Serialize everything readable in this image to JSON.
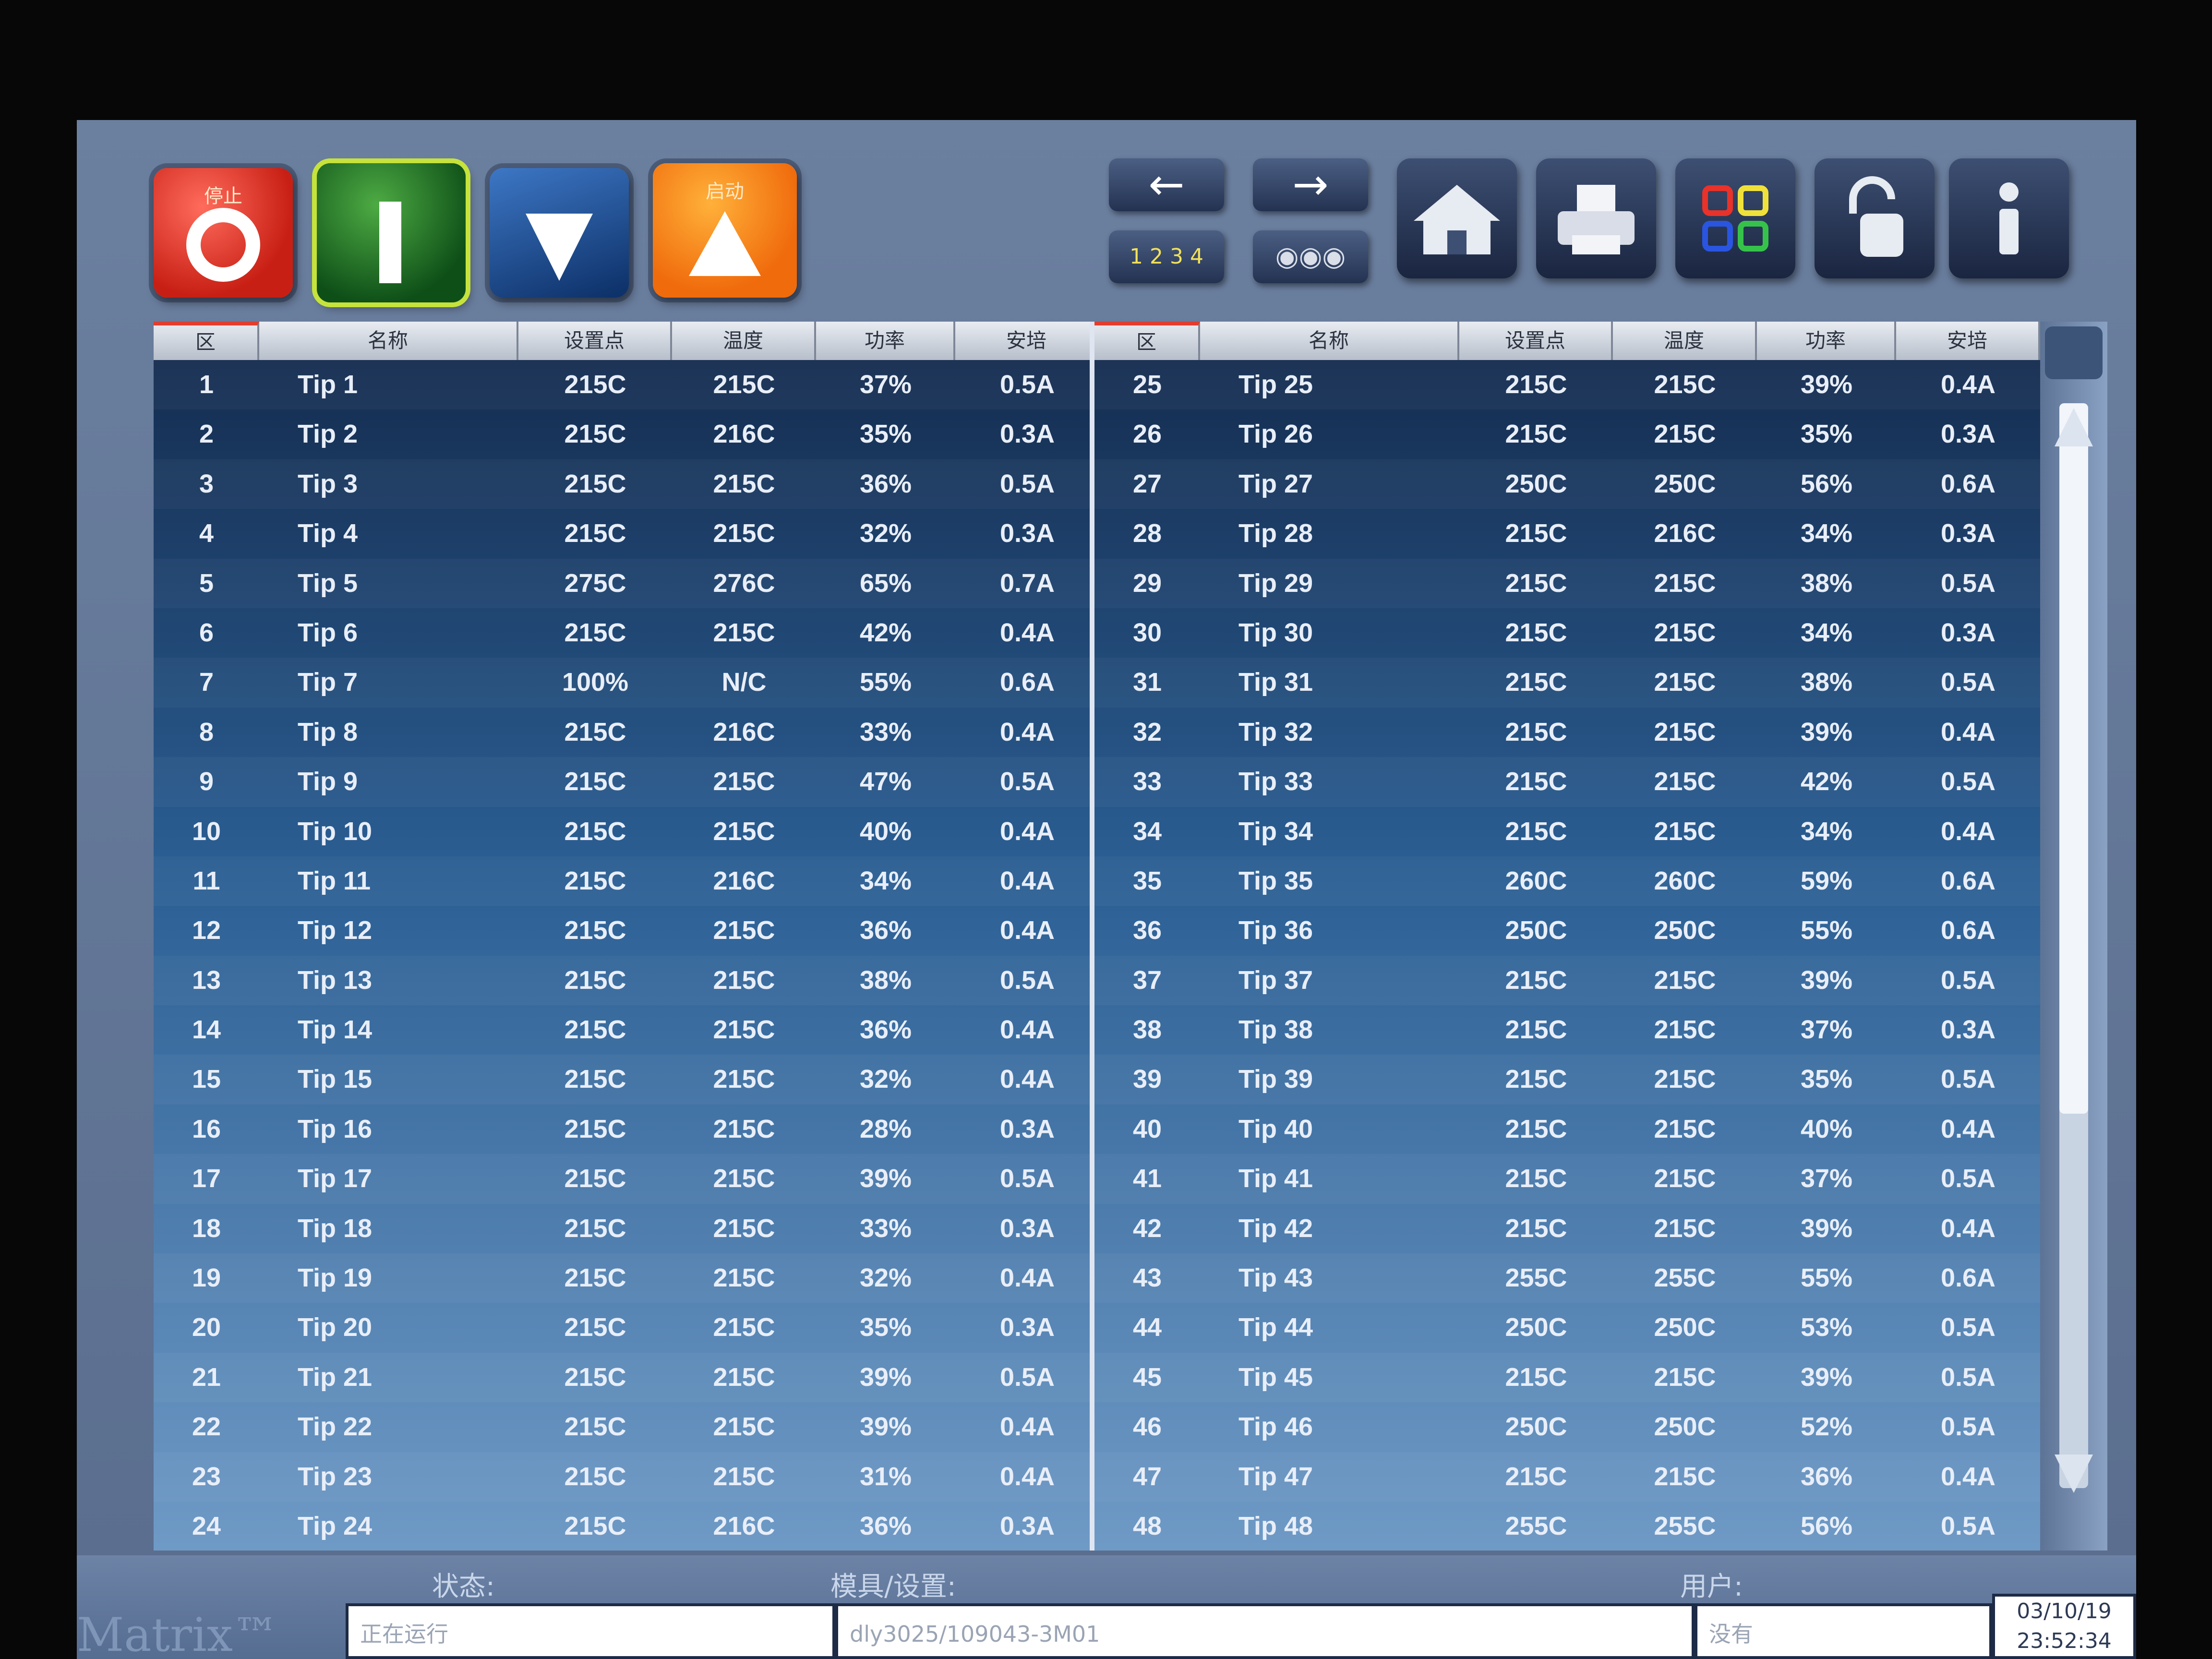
{
  "toolbar": {
    "stop_label": "停止",
    "power_label": "",
    "down_label": "",
    "start_label": "启动",
    "prev_symbol": "←",
    "next_symbol": "→",
    "page_indicator": "1 2 3 4",
    "sequence_indicator": "◉◉◉",
    "icons": [
      "stop-icon",
      "power-icon",
      "down-arrow-icon",
      "start-triangle-icon",
      "left-arrow-icon",
      "right-arrow-icon",
      "home-icon",
      "printer-icon",
      "apps-grid-icon",
      "unlock-icon",
      "info-icon"
    ]
  },
  "table": {
    "headers": [
      "区",
      "名称",
      "设置点",
      "温度",
      "功率",
      "安培"
    ],
    "left": [
      {
        "zone": "1",
        "name": "Tip 1",
        "setpoint": "215C",
        "temp": "215C",
        "power": "37%",
        "amps": "0.5A"
      },
      {
        "zone": "2",
        "name": "Tip 2",
        "setpoint": "215C",
        "temp": "216C",
        "power": "35%",
        "amps": "0.3A"
      },
      {
        "zone": "3",
        "name": "Tip 3",
        "setpoint": "215C",
        "temp": "215C",
        "power": "36%",
        "amps": "0.5A"
      },
      {
        "zone": "4",
        "name": "Tip 4",
        "setpoint": "215C",
        "temp": "215C",
        "power": "32%",
        "amps": "0.3A"
      },
      {
        "zone": "5",
        "name": "Tip 5",
        "setpoint": "275C",
        "temp": "276C",
        "power": "65%",
        "amps": "0.7A"
      },
      {
        "zone": "6",
        "name": "Tip 6",
        "setpoint": "215C",
        "temp": "215C",
        "power": "42%",
        "amps": "0.4A"
      },
      {
        "zone": "7",
        "name": "Tip 7",
        "setpoint": "100%",
        "temp": "N/C",
        "power": "55%",
        "amps": "0.6A"
      },
      {
        "zone": "8",
        "name": "Tip 8",
        "setpoint": "215C",
        "temp": "216C",
        "power": "33%",
        "amps": "0.4A"
      },
      {
        "zone": "9",
        "name": "Tip 9",
        "setpoint": "215C",
        "temp": "215C",
        "power": "47%",
        "amps": "0.5A"
      },
      {
        "zone": "10",
        "name": "Tip 10",
        "setpoint": "215C",
        "temp": "215C",
        "power": "40%",
        "amps": "0.4A"
      },
      {
        "zone": "11",
        "name": "Tip 11",
        "setpoint": "215C",
        "temp": "216C",
        "power": "34%",
        "amps": "0.4A"
      },
      {
        "zone": "12",
        "name": "Tip 12",
        "setpoint": "215C",
        "temp": "215C",
        "power": "36%",
        "amps": "0.4A"
      },
      {
        "zone": "13",
        "name": "Tip 13",
        "setpoint": "215C",
        "temp": "215C",
        "power": "38%",
        "amps": "0.5A"
      },
      {
        "zone": "14",
        "name": "Tip 14",
        "setpoint": "215C",
        "temp": "215C",
        "power": "36%",
        "amps": "0.4A"
      },
      {
        "zone": "15",
        "name": "Tip 15",
        "setpoint": "215C",
        "temp": "215C",
        "power": "32%",
        "amps": "0.4A"
      },
      {
        "zone": "16",
        "name": "Tip 16",
        "setpoint": "215C",
        "temp": "215C",
        "power": "28%",
        "amps": "0.3A"
      },
      {
        "zone": "17",
        "name": "Tip 17",
        "setpoint": "215C",
        "temp": "215C",
        "power": "39%",
        "amps": "0.5A"
      },
      {
        "zone": "18",
        "name": "Tip 18",
        "setpoint": "215C",
        "temp": "215C",
        "power": "33%",
        "amps": "0.3A"
      },
      {
        "zone": "19",
        "name": "Tip 19",
        "setpoint": "215C",
        "temp": "215C",
        "power": "32%",
        "amps": "0.4A"
      },
      {
        "zone": "20",
        "name": "Tip 20",
        "setpoint": "215C",
        "temp": "215C",
        "power": "35%",
        "amps": "0.3A"
      },
      {
        "zone": "21",
        "name": "Tip 21",
        "setpoint": "215C",
        "temp": "215C",
        "power": "39%",
        "amps": "0.5A"
      },
      {
        "zone": "22",
        "name": "Tip 22",
        "setpoint": "215C",
        "temp": "215C",
        "power": "39%",
        "amps": "0.4A"
      },
      {
        "zone": "23",
        "name": "Tip 23",
        "setpoint": "215C",
        "temp": "215C",
        "power": "31%",
        "amps": "0.4A"
      },
      {
        "zone": "24",
        "name": "Tip 24",
        "setpoint": "215C",
        "temp": "216C",
        "power": "36%",
        "amps": "0.3A"
      }
    ],
    "right": [
      {
        "zone": "25",
        "name": "Tip 25",
        "setpoint": "215C",
        "temp": "215C",
        "power": "39%",
        "amps": "0.4A"
      },
      {
        "zone": "26",
        "name": "Tip 26",
        "setpoint": "215C",
        "temp": "215C",
        "power": "35%",
        "amps": "0.3A"
      },
      {
        "zone": "27",
        "name": "Tip 27",
        "setpoint": "250C",
        "temp": "250C",
        "power": "56%",
        "amps": "0.6A"
      },
      {
        "zone": "28",
        "name": "Tip 28",
        "setpoint": "215C",
        "temp": "216C",
        "power": "34%",
        "amps": "0.3A"
      },
      {
        "zone": "29",
        "name": "Tip 29",
        "setpoint": "215C",
        "temp": "215C",
        "power": "38%",
        "amps": "0.5A"
      },
      {
        "zone": "30",
        "name": "Tip 30",
        "setpoint": "215C",
        "temp": "215C",
        "power": "34%",
        "amps": "0.3A"
      },
      {
        "zone": "31",
        "name": "Tip 31",
        "setpoint": "215C",
        "temp": "215C",
        "power": "38%",
        "amps": "0.5A"
      },
      {
        "zone": "32",
        "name": "Tip 32",
        "setpoint": "215C",
        "temp": "215C",
        "power": "39%",
        "amps": "0.4A"
      },
      {
        "zone": "33",
        "name": "Tip 33",
        "setpoint": "215C",
        "temp": "215C",
        "power": "42%",
        "amps": "0.5A"
      },
      {
        "zone": "34",
        "name": "Tip 34",
        "setpoint": "215C",
        "temp": "215C",
        "power": "34%",
        "amps": "0.4A"
      },
      {
        "zone": "35",
        "name": "Tip 35",
        "setpoint": "260C",
        "temp": "260C",
        "power": "59%",
        "amps": "0.6A"
      },
      {
        "zone": "36",
        "name": "Tip 36",
        "setpoint": "250C",
        "temp": "250C",
        "power": "55%",
        "amps": "0.6A"
      },
      {
        "zone": "37",
        "name": "Tip 37",
        "setpoint": "215C",
        "temp": "215C",
        "power": "39%",
        "amps": "0.5A"
      },
      {
        "zone": "38",
        "name": "Tip 38",
        "setpoint": "215C",
        "temp": "215C",
        "power": "37%",
        "amps": "0.3A"
      },
      {
        "zone": "39",
        "name": "Tip 39",
        "setpoint": "215C",
        "temp": "215C",
        "power": "35%",
        "amps": "0.5A"
      },
      {
        "zone": "40",
        "name": "Tip 40",
        "setpoint": "215C",
        "temp": "215C",
        "power": "40%",
        "amps": "0.4A"
      },
      {
        "zone": "41",
        "name": "Tip 41",
        "setpoint": "215C",
        "temp": "215C",
        "power": "37%",
        "amps": "0.5A"
      },
      {
        "zone": "42",
        "name": "Tip 42",
        "setpoint": "215C",
        "temp": "215C",
        "power": "39%",
        "amps": "0.4A"
      },
      {
        "zone": "43",
        "name": "Tip 43",
        "setpoint": "255C",
        "temp": "255C",
        "power": "55%",
        "amps": "0.6A"
      },
      {
        "zone": "44",
        "name": "Tip 44",
        "setpoint": "250C",
        "temp": "250C",
        "power": "53%",
        "amps": "0.5A"
      },
      {
        "zone": "45",
        "name": "Tip 45",
        "setpoint": "215C",
        "temp": "215C",
        "power": "39%",
        "amps": "0.5A"
      },
      {
        "zone": "46",
        "name": "Tip 46",
        "setpoint": "250C",
        "temp": "250C",
        "power": "52%",
        "amps": "0.5A"
      },
      {
        "zone": "47",
        "name": "Tip 47",
        "setpoint": "215C",
        "temp": "215C",
        "power": "36%",
        "amps": "0.4A"
      },
      {
        "zone": "48",
        "name": "Tip 48",
        "setpoint": "255C",
        "temp": "255C",
        "power": "56%",
        "amps": "0.5A"
      }
    ]
  },
  "status": {
    "status_label": "状态:",
    "status_value": "正在运行",
    "mold_label": "模具/设置:",
    "mold_value": "dly3025/109043-3M01",
    "user_label": "用户:",
    "user_value": "没有",
    "date": "03/10/19",
    "time": "23:52:34",
    "brand": "Matrix™"
  },
  "colors": {
    "accent_red": "#e23d2e",
    "accent_green": "#c6e33b",
    "accent_orange": "#f58a1f",
    "table_top": "#13294b",
    "table_bottom": "#6f9ac6"
  }
}
